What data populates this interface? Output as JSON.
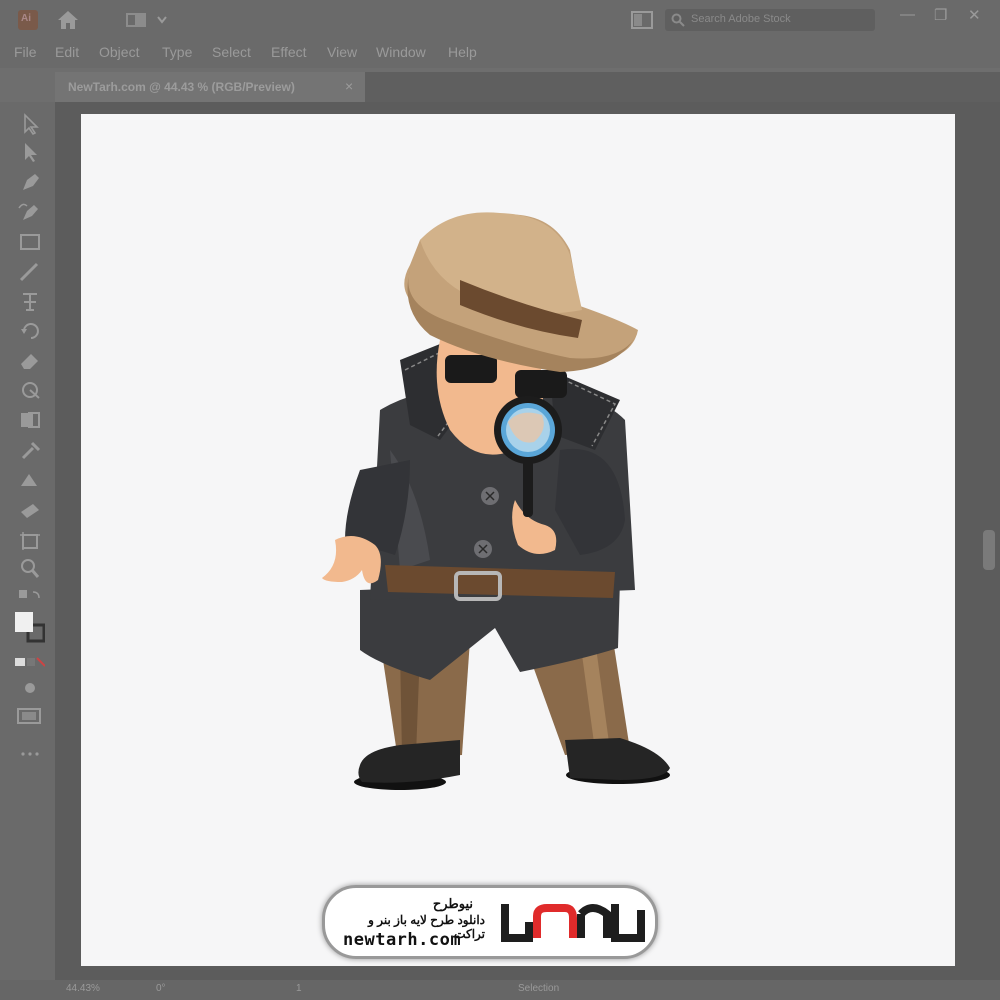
{
  "app": {
    "name": "Adobe Illustrator",
    "logo_text": "Ai"
  },
  "titlebar": {
    "search_placeholder": "Search Adobe Stock"
  },
  "menu": [
    "File",
    "Edit",
    "Object",
    "Type",
    "Select",
    "Effect",
    "View",
    "Window",
    "Help"
  ],
  "document_tab": {
    "label": "NewTarh.com @ 44.43 % (RGB/Preview)",
    "close": "×"
  },
  "status": {
    "zoom": "44.43%",
    "rotation": "0°",
    "page": "1",
    "tool": "Selection"
  },
  "tools": [
    "selection-tool",
    "direct-selection-tool",
    "pen-tool",
    "curvature-tool",
    "rectangle-tool",
    "paintbrush-tool",
    "type-tool",
    "rotate-tool",
    "eraser-tool",
    "warp-tool",
    "shape-builder-tool",
    "gradient-tool",
    "eyedropper-tool",
    "blend-tool",
    "symbol-sprayer-tool",
    "artboard-tool",
    "zoom-tool",
    "fill-stroke-swap",
    "fill-stroke",
    "color-mode",
    "draw-mode",
    "screen-mode",
    "more-tools"
  ],
  "watermark": {
    "title": "نیوطرح",
    "subtitle": "دانلود طرح لایه باز بنر و تراکت",
    "url": "newtarh.com",
    "logo_text": "نیوطرح"
  },
  "colors": {
    "hat": "#c4a27a",
    "hat_band": "#6b4a2f",
    "coat": "#3b3c3f",
    "pants": "#8a6a4a",
    "lens": "#5aa6d8",
    "skin": "#f2b98e",
    "logo_red": "#e02b2b",
    "logo_dark": "#1e1e1e"
  }
}
